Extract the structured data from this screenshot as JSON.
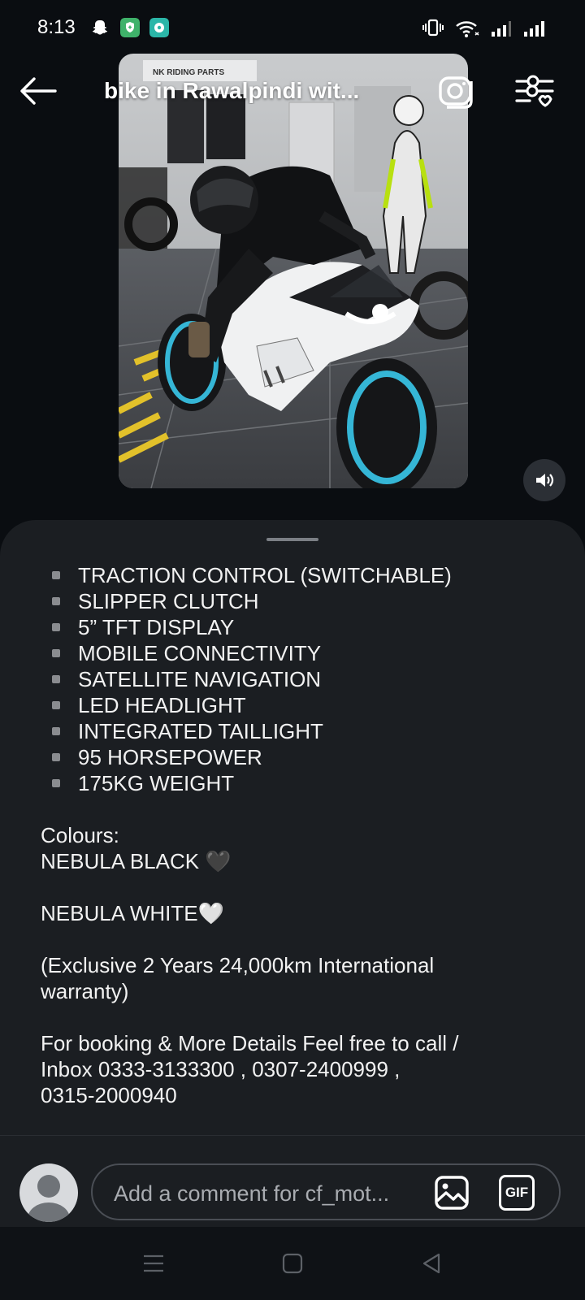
{
  "status_bar": {
    "time": "8:13"
  },
  "header": {
    "title": "bike in Rawalpindi wit..."
  },
  "caption": {
    "features": [
      "TRACTION CONTROL (SWITCHABLE)",
      "SLIPPER CLUTCH",
      "5” TFT DISPLAY",
      "MOBILE CONNECTIVITY",
      "SATELLITE NAVIGATION",
      "LED HEADLIGHT",
      "INTEGRATED TAILLIGHT",
      "95 HORSEPOWER",
      "175KG WEIGHT"
    ],
    "colours_label": "Colours:",
    "colour_black": "NEBULA BLACK 🖤",
    "colour_white": "NEBULA WHITE🤍",
    "warranty_line1": "(Exclusive 2 Years 24,000km International",
    "warranty_line2": "warranty)",
    "contact_line1": "For booking & More Details Feel free to call /",
    "contact_line2": "Inbox 0333-3133300 , 0307-2400999 ,",
    "contact_line3": "0315-2000940"
  },
  "comment": {
    "placeholder": "Add a comment for cf_mot...",
    "gif_label": "GIF"
  },
  "video": {
    "showroom_sign": "NK RIDING PARTS"
  }
}
